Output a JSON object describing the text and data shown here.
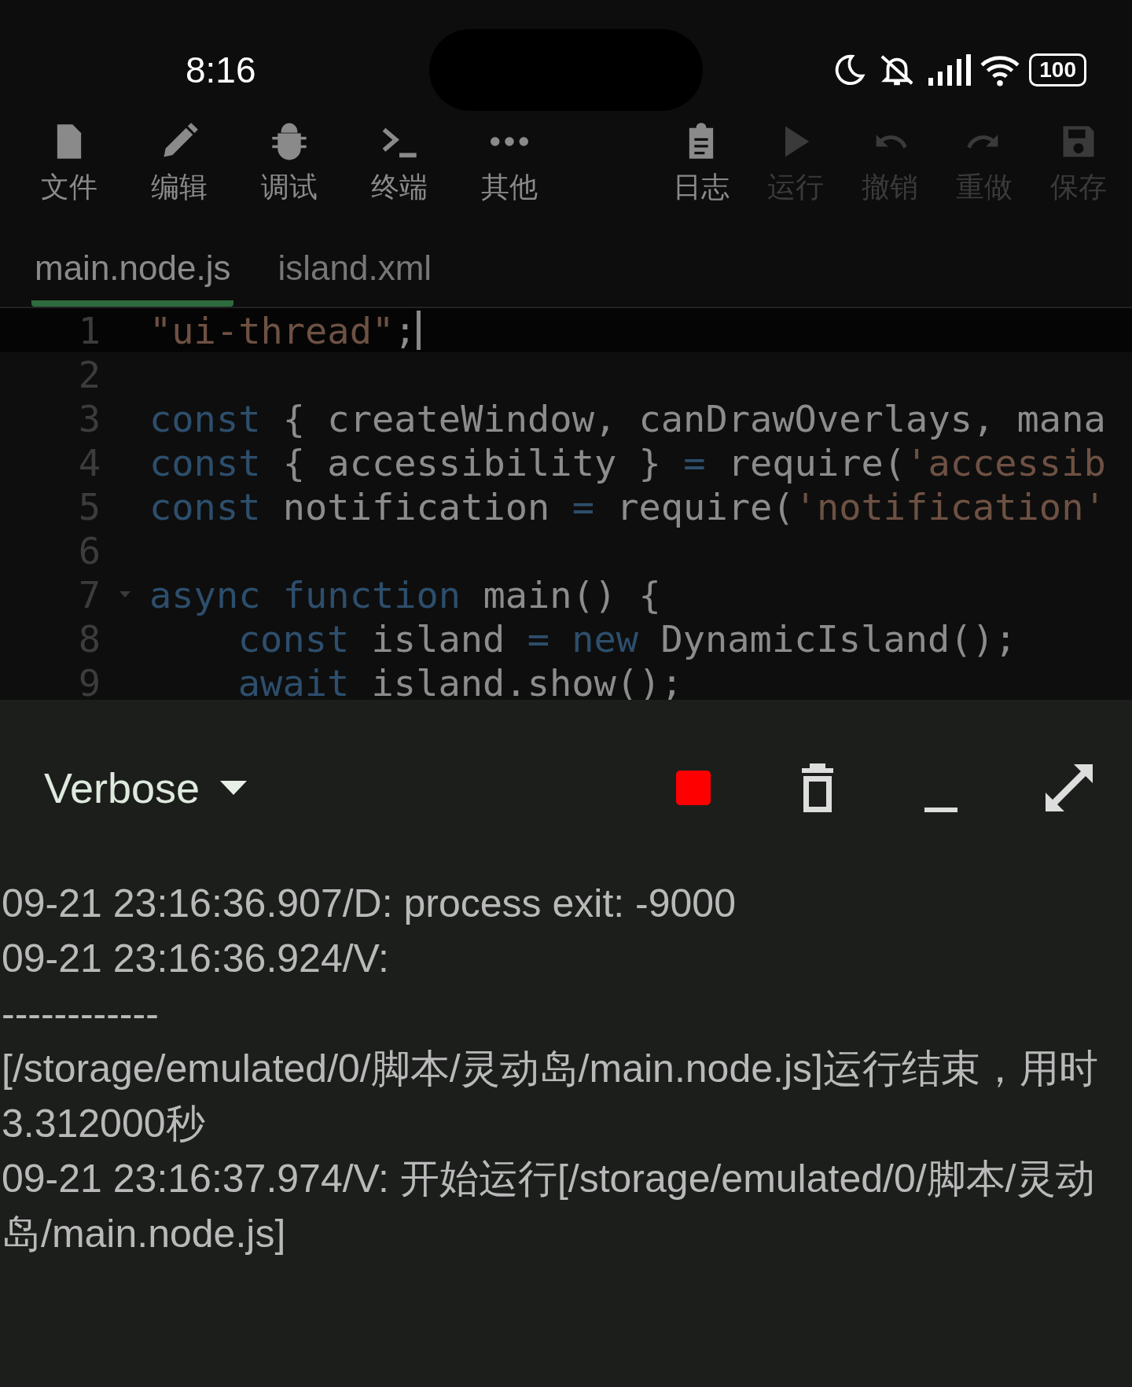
{
  "status_bar": {
    "time": "8:16",
    "battery": "100"
  },
  "toolbar": {
    "left": [
      {
        "label": "文件",
        "disabled": false
      },
      {
        "label": "编辑",
        "disabled": false
      },
      {
        "label": "调试",
        "disabled": false
      },
      {
        "label": "终端",
        "disabled": false
      },
      {
        "label": "其他",
        "disabled": false
      }
    ],
    "right": [
      {
        "label": "日志",
        "disabled": false
      },
      {
        "label": "运行",
        "disabled": true
      },
      {
        "label": "撤销",
        "disabled": true
      },
      {
        "label": "重做",
        "disabled": true
      },
      {
        "label": "保存",
        "disabled": true
      }
    ]
  },
  "tabs": [
    {
      "label": "main.node.js",
      "selected": true
    },
    {
      "label": "island.xml",
      "selected": false
    }
  ],
  "editor": {
    "lines": [
      {
        "number": "1",
        "current": true,
        "foldable": false,
        "indent": false,
        "tokens": [
          {
            "kind": "string",
            "text": "\"ui-thread\""
          },
          {
            "kind": "plain",
            "text": ";"
          }
        ]
      },
      {
        "number": "2",
        "current": false,
        "foldable": false
      },
      {
        "number": "3",
        "current": false,
        "foldable": false,
        "indent": false,
        "tokens": [
          {
            "kind": "keyword",
            "text": "const"
          },
          {
            "kind": "plain",
            "text": " { createWindow, canDrawOverlays, mana"
          }
        ]
      },
      {
        "number": "4",
        "current": false,
        "foldable": false,
        "indent": false,
        "tokens": [
          {
            "kind": "keyword",
            "text": "const"
          },
          {
            "kind": "plain",
            "text": " { accessibility } "
          },
          {
            "kind": "keyword",
            "text": "="
          },
          {
            "kind": "plain",
            "text": " require("
          },
          {
            "kind": "string",
            "text": "'accessib"
          }
        ]
      },
      {
        "number": "5",
        "current": false,
        "foldable": false,
        "indent": false,
        "tokens": [
          {
            "kind": "keyword",
            "text": "const"
          },
          {
            "kind": "plain",
            "text": " notification "
          },
          {
            "kind": "keyword",
            "text": "="
          },
          {
            "kind": "plain",
            "text": " require("
          },
          {
            "kind": "string",
            "text": "'notification'"
          }
        ]
      },
      {
        "number": "6",
        "current": false,
        "foldable": false
      },
      {
        "number": "7",
        "current": false,
        "foldable": true,
        "indent": false,
        "tokens": [
          {
            "kind": "keyword",
            "text": "async"
          },
          {
            "kind": "keyword",
            "text": " function"
          },
          {
            "kind": "plain",
            "text": " main() {"
          }
        ]
      },
      {
        "number": "8",
        "current": false,
        "foldable": false,
        "indent": true,
        "tokens": [
          {
            "kind": "keyword",
            "text": "const"
          },
          {
            "kind": "plain",
            "text": " island "
          },
          {
            "kind": "keyword",
            "text": "="
          },
          {
            "kind": "keyword",
            "text": " new"
          },
          {
            "kind": "plain",
            "text": " DynamicIsland();"
          }
        ]
      },
      {
        "number": "9",
        "current": false,
        "foldable": false,
        "indent": true,
        "tokens": [
          {
            "kind": "keyword",
            "text": "await"
          },
          {
            "kind": "plain",
            "text": " island.show();"
          }
        ]
      }
    ]
  },
  "log_panel": {
    "level": "Verbose",
    "entries": [
      "09-21 23:16:36.907/D: process exit: -9000",
      "09-21 23:16:36.924/V:",
      "------------",
      "[/storage/emulated/0/脚本/灵动岛/main.node.js]运行结束，用时3.312000秒",
      "09-21 23:16:37.974/V: 开始运行[/storage/emulated/0/脚本/灵动岛/main.node.js]"
    ]
  }
}
